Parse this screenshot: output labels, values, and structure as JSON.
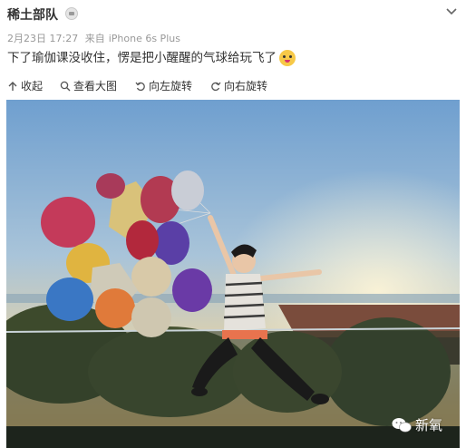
{
  "post": {
    "username": "稀土部队",
    "date": "2月23日 17:27",
    "source_prefix": "来自",
    "source": "iPhone 6s Plus",
    "text": "下了瑜伽课没收住，愣是把小醒醒的气球给玩飞了"
  },
  "toolbar": {
    "collapse": "收起",
    "view_large": "查看大图",
    "rotate_left": "向左旋转",
    "rotate_right": "向右旋转"
  },
  "photo": {
    "description_icon": "photo",
    "watermark": "新氧"
  },
  "icons": {
    "badge": "crown-badge-icon",
    "chevron": "chevron-down-icon",
    "emoji": "tongue-out-emoji-icon"
  }
}
